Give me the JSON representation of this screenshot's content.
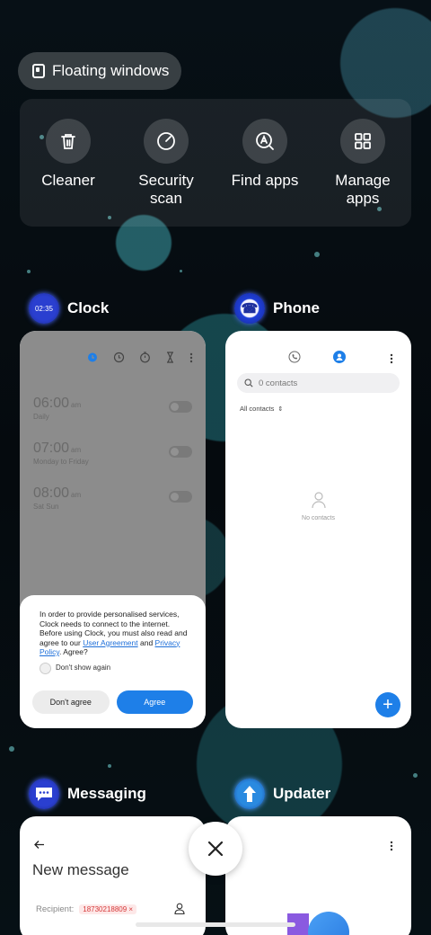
{
  "floating_windows": {
    "label": "Floating windows"
  },
  "quick_actions": [
    {
      "id": "cleaner",
      "line1": "Cleaner",
      "line2": ""
    },
    {
      "id": "security",
      "line1": "Security",
      "line2": "scan"
    },
    {
      "id": "findapps",
      "line1": "Find apps",
      "line2": ""
    },
    {
      "id": "manage",
      "line1": "Manage",
      "line2": "apps"
    }
  ],
  "clock": {
    "app_name": "Clock",
    "icon_time": "02:35",
    "alarms": [
      {
        "time": "06:00",
        "ampm": "am",
        "repeat": "Daily"
      },
      {
        "time": "07:00",
        "ampm": "am",
        "repeat": "Monday to Friday"
      },
      {
        "time": "08:00",
        "ampm": "am",
        "repeat": "Sat Sun"
      }
    ],
    "dialog": {
      "text_before": "In order to provide personalised services, Clock needs to connect to the internet. Before using Clock, you must also read and agree to our ",
      "user_agreement": "User Agreement",
      "and": " and ",
      "privacy_policy": "Privacy Policy",
      "text_after": ". Agree?",
      "dont_show": "Don't show again",
      "disagree": "Don't agree",
      "agree": "Agree"
    }
  },
  "phone": {
    "app_name": "Phone",
    "search_placeholder": "0 contacts",
    "filter": "All contacts",
    "empty": "No contacts",
    "fab": "+"
  },
  "messaging": {
    "app_name": "Messaging",
    "title": "New message",
    "recipient_label": "Recipient:",
    "recipient_chip": "18730218809"
  },
  "updater": {
    "app_name": "Updater"
  },
  "colors": {
    "accent": "#1e7fe8",
    "link": "#1e6fd9"
  }
}
